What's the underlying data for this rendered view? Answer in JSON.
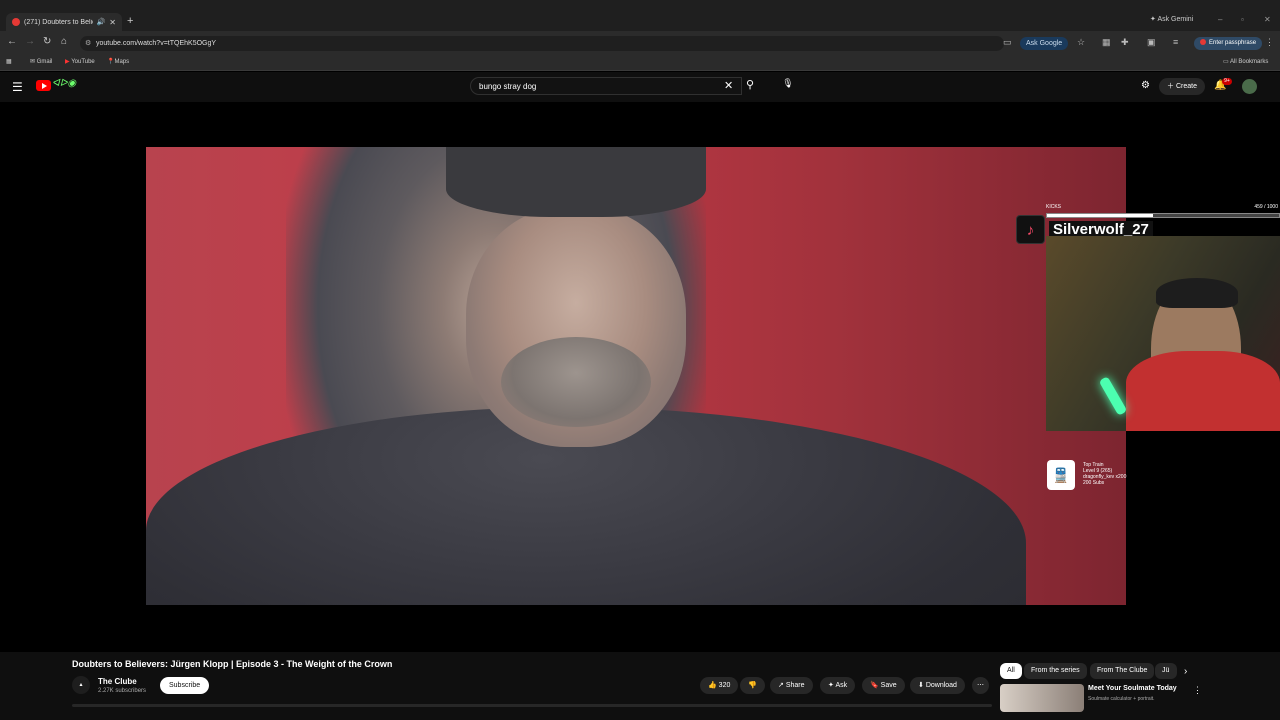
{
  "browser": {
    "tab_title": "(271) Doubters to Believers: ...",
    "new_tab": "+",
    "ask_gemini": "Ask Gemini",
    "url": "youtube.com/watch?v=tTQEhK5OGgY",
    "ask_google": "Ask Google",
    "passphrase": "Enter passphrase",
    "bookmarks": [
      "Gmail",
      "YouTube",
      "Maps"
    ],
    "all_bookmarks": "All Bookmarks"
  },
  "youtube": {
    "search_value": "bungo stray dog",
    "create_label": "Create",
    "notif_count": "9+"
  },
  "overlay": {
    "kicks_label": "KICKS",
    "kicks_count": "459 / 1000",
    "kicks_progress": 0.459,
    "tiktok_name": "Silverwolf_27",
    "train_lines": [
      "Top Train",
      "Level 9 (265)",
      "dragonfly_kev x200",
      "200 Subs"
    ]
  },
  "video": {
    "title": "Doubters to Believers: Jürgen Klopp | Episode 3 - The Weight of the Crown",
    "channel_name": "The Clube",
    "channel_subs": "2.27K subscribers",
    "subscribe_label": "Subscribe",
    "like_count": "320",
    "share_label": "Share",
    "ask_label": "Ask",
    "save_label": "Save",
    "download_label": "Download"
  },
  "sidebar": {
    "chips": [
      "All",
      "From the series",
      "From The Clube",
      "Jü"
    ],
    "rec_title": "Meet Your Soulmate Today",
    "rec_sub": "Soulmate calculator + portrait."
  },
  "icons": {
    "accent": "#ff0000",
    "tiktok_color": "#ff4b6b",
    "glow_color": "#4cffb0"
  }
}
